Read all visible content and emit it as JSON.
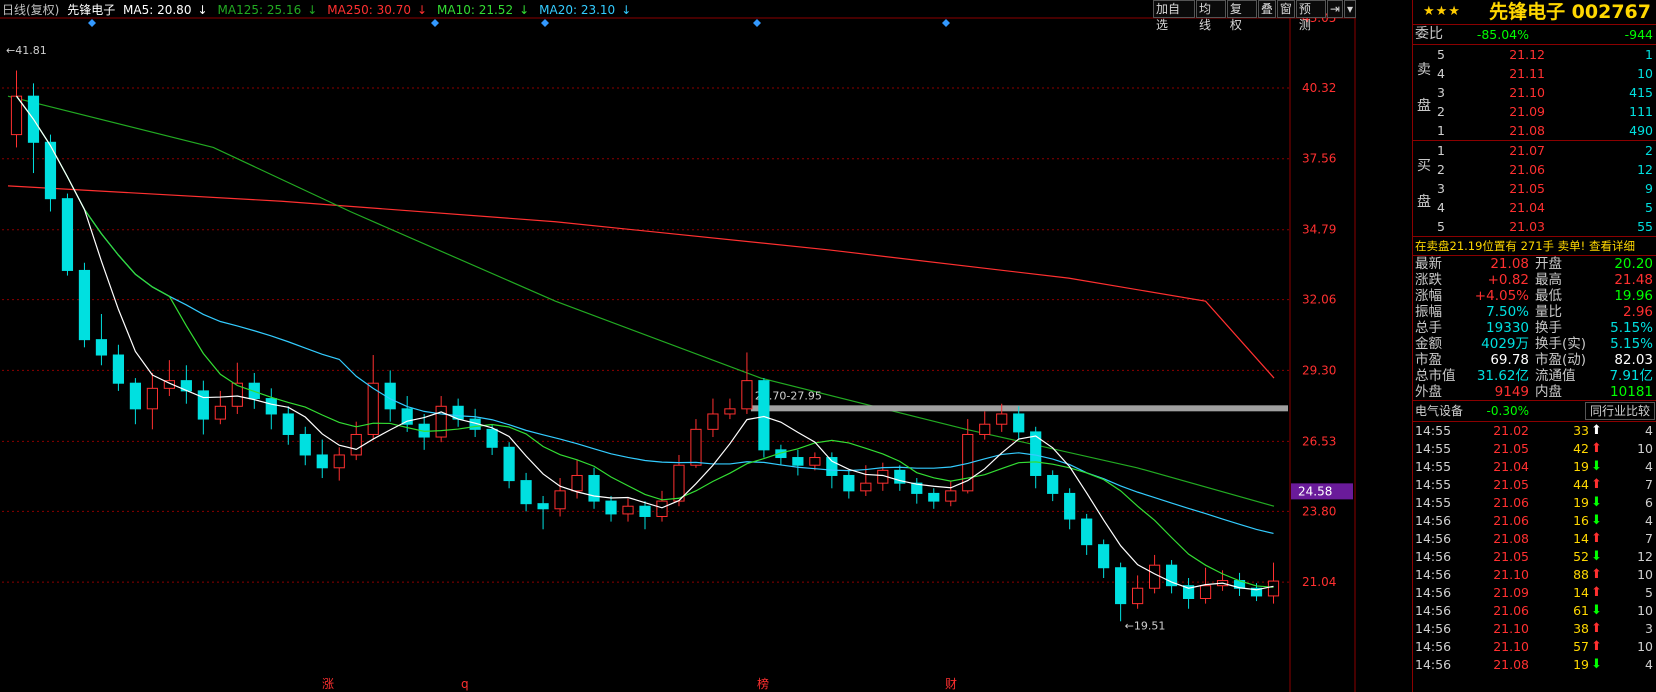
{
  "header": {
    "chart_label": "日线(复权)",
    "stock": "先锋电子",
    "ma": [
      {
        "label": "MA5: 20.80",
        "arrow": "↓",
        "color": "#ffffff"
      },
      {
        "label": "MA125: 25.16",
        "arrow": "↓",
        "color": "#22aa22"
      },
      {
        "label": "MA250: 30.70",
        "arrow": "↓",
        "color": "#ff3030"
      },
      {
        "label": "MA10: 21.52",
        "arrow": "↓",
        "color": "#33dd33"
      },
      {
        "label": "MA20: 23.10",
        "arrow": "↓",
        "color": "#33ccff"
      }
    ]
  },
  "toolbar": [
    "加自选",
    "均线",
    "复权",
    "叠",
    "窗",
    "预测",
    "⇥",
    "▾"
  ],
  "colors": {
    "up": "#ff3030",
    "down": "#00e0e0",
    "grid": "#8b0000",
    "axis_text": "#ff3030",
    "ma5": "#ffffff",
    "ma10": "#33dd33",
    "ma20": "#33ccff",
    "ma125": "#22aa22",
    "ma250": "#ff3030"
  },
  "chart_data": {
    "type": "candlestick",
    "y_ticks": [
      "43.05",
      "40.32",
      "37.56",
      "34.79",
      "32.06",
      "29.30",
      "26.53",
      "23.80",
      "21.04"
    ],
    "ylim": [
      18.0,
      43.05
    ],
    "current_price_tag": "24.58",
    "max_label": "41.81",
    "min_label": "19.51",
    "range_label": "27.70-27.95",
    "range_value": 27.82,
    "event_markers": [
      "涨",
      "q",
      "榜",
      "财"
    ],
    "candles": [
      [
        38.5,
        40.0,
        41.0,
        38.0
      ],
      [
        40.0,
        38.2,
        40.5,
        37.0
      ],
      [
        38.2,
        36.0,
        38.5,
        35.5
      ],
      [
        36.0,
        33.2,
        36.2,
        33.0
      ],
      [
        33.2,
        30.5,
        33.5,
        30.2
      ],
      [
        30.5,
        29.9,
        31.5,
        29.5
      ],
      [
        29.9,
        28.8,
        30.3,
        28.5
      ],
      [
        28.8,
        27.8,
        29.0,
        27.2
      ],
      [
        27.8,
        28.6,
        29.2,
        27.0
      ],
      [
        28.6,
        28.9,
        29.7,
        28.3
      ],
      [
        28.9,
        28.5,
        29.5,
        28.0
      ],
      [
        28.5,
        27.4,
        28.9,
        26.8
      ],
      [
        27.4,
        27.9,
        28.5,
        27.2
      ],
      [
        27.9,
        28.8,
        29.6,
        27.6
      ],
      [
        28.8,
        28.2,
        29.2,
        27.8
      ],
      [
        28.2,
        27.6,
        28.6,
        27.0
      ],
      [
        27.6,
        26.8,
        27.9,
        26.4
      ],
      [
        26.8,
        26.0,
        27.1,
        25.6
      ],
      [
        26.0,
        25.5,
        26.6,
        25.1
      ],
      [
        25.5,
        26.0,
        26.3,
        25.0
      ],
      [
        26.0,
        26.8,
        27.3,
        25.8
      ],
      [
        26.8,
        28.8,
        29.9,
        26.6
      ],
      [
        28.8,
        27.8,
        29.3,
        27.3
      ],
      [
        27.8,
        27.2,
        28.3,
        26.9
      ],
      [
        27.2,
        26.7,
        27.6,
        26.2
      ],
      [
        26.7,
        27.9,
        28.3,
        26.5
      ],
      [
        27.9,
        27.4,
        28.2,
        27.1
      ],
      [
        27.4,
        27.0,
        27.8,
        26.7
      ],
      [
        27.0,
        26.3,
        27.2,
        26.0
      ],
      [
        26.3,
        25.0,
        26.5,
        24.7
      ],
      [
        25.0,
        24.1,
        25.3,
        23.8
      ],
      [
        24.1,
        23.9,
        24.4,
        23.1
      ],
      [
        23.9,
        24.6,
        25.1,
        23.6
      ],
      [
        24.6,
        25.2,
        25.8,
        24.3
      ],
      [
        25.2,
        24.2,
        25.5,
        23.9
      ],
      [
        24.2,
        23.7,
        24.4,
        23.4
      ],
      [
        23.7,
        24.0,
        24.3,
        23.4
      ],
      [
        24.0,
        23.6,
        24.2,
        23.1
      ],
      [
        23.6,
        24.2,
        24.6,
        23.4
      ],
      [
        24.2,
        25.6,
        26.0,
        24.0
      ],
      [
        25.6,
        27.0,
        27.4,
        25.5
      ],
      [
        27.0,
        27.6,
        28.2,
        26.7
      ],
      [
        27.6,
        27.8,
        28.2,
        27.4
      ],
      [
        27.8,
        28.9,
        30.0,
        27.6
      ],
      [
        28.9,
        26.2,
        29.0,
        25.9
      ],
      [
        26.2,
        25.9,
        26.4,
        25.6
      ],
      [
        25.9,
        25.6,
        26.2,
        25.2
      ],
      [
        25.6,
        25.9,
        26.1,
        25.4
      ],
      [
        25.9,
        25.2,
        26.1,
        24.7
      ],
      [
        25.2,
        24.6,
        25.4,
        24.3
      ],
      [
        24.6,
        24.9,
        25.6,
        24.4
      ],
      [
        24.9,
        25.4,
        25.7,
        24.6
      ],
      [
        25.4,
        24.9,
        25.6,
        24.6
      ],
      [
        24.9,
        24.5,
        25.1,
        24.1
      ],
      [
        24.5,
        24.2,
        24.7,
        23.9
      ],
      [
        24.2,
        24.6,
        25.0,
        24.0
      ],
      [
        24.6,
        26.8,
        27.4,
        24.5
      ],
      [
        26.8,
        27.2,
        27.7,
        26.6
      ],
      [
        27.2,
        27.6,
        28.0,
        26.9
      ],
      [
        27.6,
        26.9,
        27.9,
        26.6
      ],
      [
        26.9,
        25.2,
        27.1,
        24.7
      ],
      [
        25.2,
        24.5,
        25.4,
        24.2
      ],
      [
        24.5,
        23.5,
        24.7,
        23.1
      ],
      [
        23.5,
        22.5,
        23.7,
        22.1
      ],
      [
        22.5,
        21.6,
        22.7,
        21.2
      ],
      [
        21.6,
        20.2,
        21.8,
        19.51
      ],
      [
        20.2,
        20.8,
        21.3,
        20.0
      ],
      [
        20.8,
        21.7,
        22.1,
        20.6
      ],
      [
        21.7,
        20.9,
        21.9,
        20.6
      ],
      [
        20.9,
        20.4,
        21.2,
        20.0
      ],
      [
        20.4,
        20.9,
        21.6,
        20.2
      ],
      [
        20.9,
        21.1,
        21.5,
        20.7
      ],
      [
        21.1,
        20.8,
        21.4,
        20.5
      ],
      [
        20.8,
        20.5,
        21.0,
        20.3
      ],
      [
        20.5,
        21.08,
        21.8,
        20.2
      ]
    ],
    "ma250": [
      [
        0,
        36.5
      ],
      [
        16,
        35.9
      ],
      [
        32,
        35.1
      ],
      [
        48,
        34.0
      ],
      [
        62,
        32.9
      ],
      [
        70,
        32.0
      ],
      [
        74,
        29.0
      ]
    ],
    "ma125": [
      [
        0,
        40.0
      ],
      [
        12,
        38.0
      ],
      [
        20,
        35.5
      ],
      [
        32,
        32.0
      ],
      [
        44,
        29.0
      ],
      [
        56,
        27.0
      ],
      [
        66,
        25.5
      ],
      [
        74,
        24.0
      ]
    ]
  },
  "panel": {
    "stars": "★★★",
    "title": "先锋电子 002767",
    "weibi": {
      "label": "委比",
      "pct": "-85.04%",
      "val": "-944"
    },
    "sell_label": [
      "卖",
      "盘"
    ],
    "buy_label": [
      "买",
      "盘"
    ],
    "sells": [
      {
        "lv": "5",
        "price": "21.12",
        "vol": "1"
      },
      {
        "lv": "4",
        "price": "21.11",
        "vol": "10"
      },
      {
        "lv": "3",
        "price": "21.10",
        "vol": "415"
      },
      {
        "lv": "2",
        "price": "21.09",
        "vol": "111"
      },
      {
        "lv": "1",
        "price": "21.08",
        "vol": "490"
      }
    ],
    "buys": [
      {
        "lv": "1",
        "price": "21.07",
        "vol": "2"
      },
      {
        "lv": "2",
        "price": "21.06",
        "vol": "12"
      },
      {
        "lv": "3",
        "price": "21.05",
        "vol": "9"
      },
      {
        "lv": "4",
        "price": "21.04",
        "vol": "5"
      },
      {
        "lv": "5",
        "price": "21.03",
        "vol": "55"
      }
    ],
    "notice": "在卖盘21.19位置有  271手  卖单! 查看详细",
    "quotes": [
      {
        "k1": "最新",
        "v1": "21.08",
        "c1": "red",
        "k2": "开盘",
        "v2": "20.20",
        "c2": "green"
      },
      {
        "k1": "涨跌",
        "v1": "+0.82",
        "c1": "red",
        "k2": "最高",
        "v2": "21.48",
        "c2": "red"
      },
      {
        "k1": "涨幅",
        "v1": "+4.05%",
        "c1": "red",
        "k2": "最低",
        "v2": "19.96",
        "c2": "green"
      },
      {
        "k1": "振幅",
        "v1": "7.50%",
        "c1": "cyan",
        "k2": "量比",
        "v2": "2.96",
        "c2": "red"
      },
      {
        "k1": "总手",
        "v1": "19330",
        "c1": "cyan",
        "k2": "换手",
        "v2": "5.15%",
        "c2": "cyan"
      },
      {
        "k1": "金额",
        "v1": "4029万",
        "c1": "cyan",
        "k2": "换手(实)",
        "v2": "5.15%",
        "c2": "cyan"
      },
      {
        "k1": "市盈",
        "v1": "69.78",
        "c1": "white",
        "k2": "市盈(动)",
        "v2": "82.03",
        "c2": "white"
      },
      {
        "k1": "总市值",
        "v1": "31.62亿",
        "c1": "cyan",
        "k2": "流通值",
        "v2": "7.91亿",
        "c2": "cyan"
      },
      {
        "k1": "外盘",
        "v1": "9149",
        "c1": "red",
        "k2": "内盘",
        "v2": "10181",
        "c2": "green"
      }
    ],
    "industry": {
      "name": "电气设备",
      "pct": "-0.30%",
      "btn": "同行业比较"
    },
    "ticks": [
      {
        "t": "14:55",
        "p": "21.02",
        "v": "33",
        "dir": "up-w",
        "n": "4"
      },
      {
        "t": "14:55",
        "p": "21.05",
        "v": "42",
        "dir": "up",
        "n": "10"
      },
      {
        "t": "14:55",
        "p": "21.04",
        "v": "19",
        "dir": "down",
        "n": "4"
      },
      {
        "t": "14:55",
        "p": "21.05",
        "v": "44",
        "dir": "up",
        "n": "7"
      },
      {
        "t": "14:55",
        "p": "21.06",
        "v": "19",
        "dir": "down",
        "n": "6"
      },
      {
        "t": "14:56",
        "p": "21.06",
        "v": "16",
        "dir": "down",
        "n": "4"
      },
      {
        "t": "14:56",
        "p": "21.08",
        "v": "14",
        "dir": "up",
        "n": "7"
      },
      {
        "t": "14:56",
        "p": "21.05",
        "v": "52",
        "dir": "down",
        "n": "12"
      },
      {
        "t": "14:56",
        "p": "21.10",
        "v": "88",
        "dir": "up",
        "n": "10"
      },
      {
        "t": "14:56",
        "p": "21.09",
        "v": "14",
        "dir": "up",
        "n": "5"
      },
      {
        "t": "14:56",
        "p": "21.06",
        "v": "61",
        "dir": "down",
        "n": "10"
      },
      {
        "t": "14:56",
        "p": "21.10",
        "v": "38",
        "dir": "up",
        "n": "3"
      },
      {
        "t": "14:56",
        "p": "21.10",
        "v": "57",
        "dir": "up",
        "n": "10"
      },
      {
        "t": "14:56",
        "p": "21.08",
        "v": "19",
        "dir": "down",
        "n": "4"
      }
    ]
  }
}
